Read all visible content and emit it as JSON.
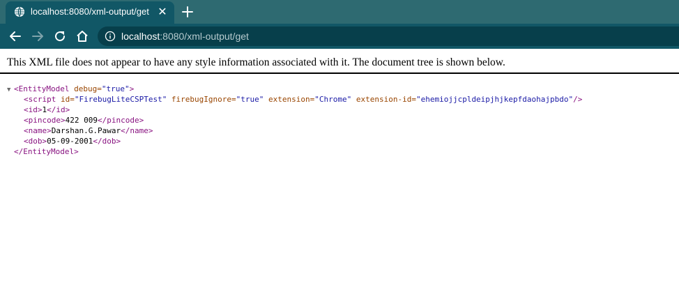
{
  "tab": {
    "title": "localhost:8080/xml-output/get",
    "close_glyph": "✕"
  },
  "address": {
    "host": "localhost",
    "rest": ":8080/xml-output/get"
  },
  "page": {
    "info_text": "This XML file does not appear to have any style information associated with it. The document tree is shown below.",
    "tree": {
      "toggle_glyph": "▼",
      "root_open": "<EntityModel",
      "root_attr_name": " debug=",
      "root_attr_value": "\"true\"",
      "root_open_end": ">",
      "script_open": "<script",
      "script_attr1_name": " id=",
      "script_attr1_value": "\"FirebugLiteCSPTest\"",
      "script_attr2_name": " firebugIgnore=",
      "script_attr2_value": "\"true\"",
      "script_attr3_name": " extension=",
      "script_attr3_value": "\"Chrome\"",
      "script_attr4_name": " extension-id=",
      "script_attr4_value": "\"ehemiojjcpldeipjhjkepfdaohajpbdo\"",
      "script_close": "/>",
      "id_open": "<id>",
      "id_value": "1",
      "id_close": "</id>",
      "pincode_open": "<pincode>",
      "pincode_value": "422 009",
      "pincode_close": "</pincode>",
      "name_open": "<name>",
      "name_value": "Darshan.G.Pawar",
      "name_close": "</name>",
      "dob_open": "<dob>",
      "dob_value": "05-09-2001",
      "dob_close": "</dob>",
      "root_close": "</EntityModel>"
    }
  },
  "colors": {
    "tabstrip_bg": "#2e6a71",
    "toolbar_bg": "#115766",
    "omnibox_bg": "#073f4b",
    "xml_tag": "#881280",
    "xml_attr": "#994500",
    "xml_value": "#1a1aa6"
  },
  "icons": {
    "tab_favicon": "globe-icon",
    "new_tab": "plus-icon",
    "back": "arrow-left-icon",
    "forward": "arrow-right-icon",
    "reload": "reload-icon",
    "home": "home-icon",
    "site_info": "info-icon"
  }
}
